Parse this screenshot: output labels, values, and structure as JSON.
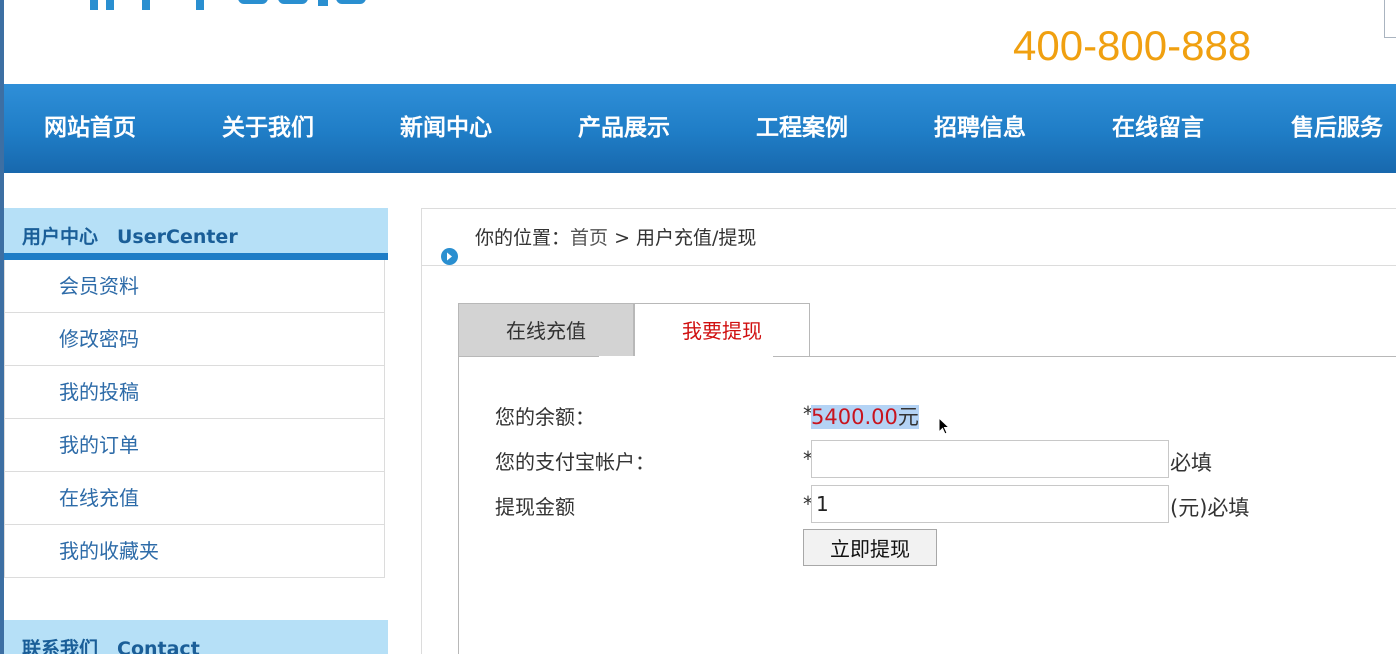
{
  "header": {
    "phone": "400-800-888"
  },
  "nav": {
    "items": [
      "网站首页",
      "关于我们",
      "新闻中心",
      "产品展示",
      "工程案例",
      "招聘信息",
      "在线留言",
      "售后服务"
    ]
  },
  "sidebar": {
    "title": "用户中心　UserCenter",
    "items": [
      "会员资料",
      "修改密码",
      "我的投稿",
      "我的订单",
      "在线充值",
      "我的收藏夹"
    ],
    "contact_title": "联系我们　Contact"
  },
  "breadcrumb": {
    "prefix": "你的位置：",
    "home": "首页",
    "separator": " > ",
    "current": "用户充值/提现"
  },
  "tabs": {
    "recharge": "在线充值",
    "withdraw": "我要提现"
  },
  "form": {
    "balance_label": "您的余额：",
    "balance_value": "5400.00",
    "balance_unit": "元",
    "alipay_label": "您的支付宝帐户：",
    "alipay_value": "",
    "alipay_hint": "必填",
    "amount_label": "提现金额",
    "amount_value": "1",
    "amount_hint": "(元)必填",
    "required_mark": "*",
    "submit_label": "立即提现"
  },
  "colors": {
    "nav_bg": "#1f7dc6",
    "phone": "#f0a010",
    "link": "#2d6ba8",
    "active_tab": "#d01010",
    "balance": "#c8141e"
  }
}
